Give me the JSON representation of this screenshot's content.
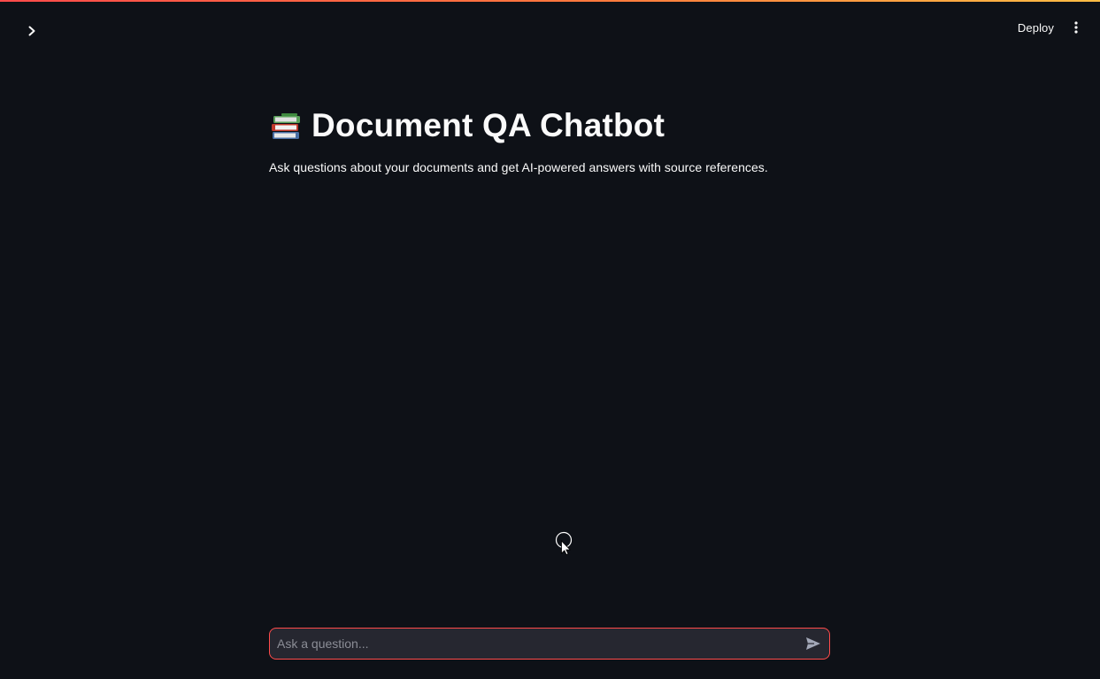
{
  "header": {
    "sidebar_toggle_icon": "chevron-right-icon",
    "deploy_label": "Deploy",
    "menu_icon": "vertical-ellipsis-icon"
  },
  "main": {
    "title_icon": "books-icon",
    "title": "Document QA Chatbot",
    "subtitle": "Ask questions about your documents and get AI-powered answers with source references."
  },
  "chat_input": {
    "placeholder": "Ask a question...",
    "value": "",
    "send_icon": "send-icon"
  },
  "colors": {
    "background": "#0e1117",
    "text": "#fafafa",
    "accent": "#ff4b4b",
    "input_background": "#262730",
    "placeholder": "#8b8d96"
  }
}
